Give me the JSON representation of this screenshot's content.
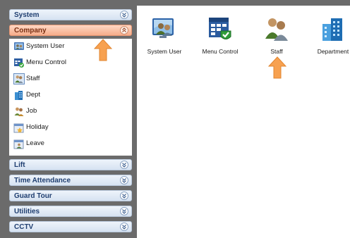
{
  "sidebar": {
    "panels": [
      {
        "label": "System",
        "state": "collapsed"
      },
      {
        "label": "Company",
        "state": "expanded"
      },
      {
        "label": "Lift",
        "state": "collapsed"
      },
      {
        "label": "Time Attendance",
        "state": "collapsed"
      },
      {
        "label": "Guard Tour",
        "state": "collapsed"
      },
      {
        "label": "Utilities",
        "state": "collapsed"
      },
      {
        "label": "CCTV",
        "state": "collapsed"
      }
    ],
    "company_items": [
      {
        "label": "System User",
        "icon": "system-user-icon"
      },
      {
        "label": "Menu Control",
        "icon": "menu-control-icon"
      },
      {
        "label": "Staff",
        "icon": "staff-icon"
      },
      {
        "label": "Dept",
        "icon": "department-icon"
      },
      {
        "label": "Job",
        "icon": "job-icon"
      },
      {
        "label": "Holiday",
        "icon": "holiday-icon"
      },
      {
        "label": "Leave",
        "icon": "leave-icon"
      }
    ]
  },
  "main": {
    "items": [
      {
        "label": "System User",
        "icon": "system-user-icon"
      },
      {
        "label": "Menu Control",
        "icon": "menu-control-icon"
      },
      {
        "label": "Staff",
        "icon": "staff-icon"
      },
      {
        "label": "Department",
        "icon": "department-icon"
      }
    ]
  },
  "colors": {
    "sidebar_bg": "#6b6b6b",
    "header_text": "#1f3e70",
    "active_header": "#f6ac8a",
    "arrow": "#f7a150"
  }
}
